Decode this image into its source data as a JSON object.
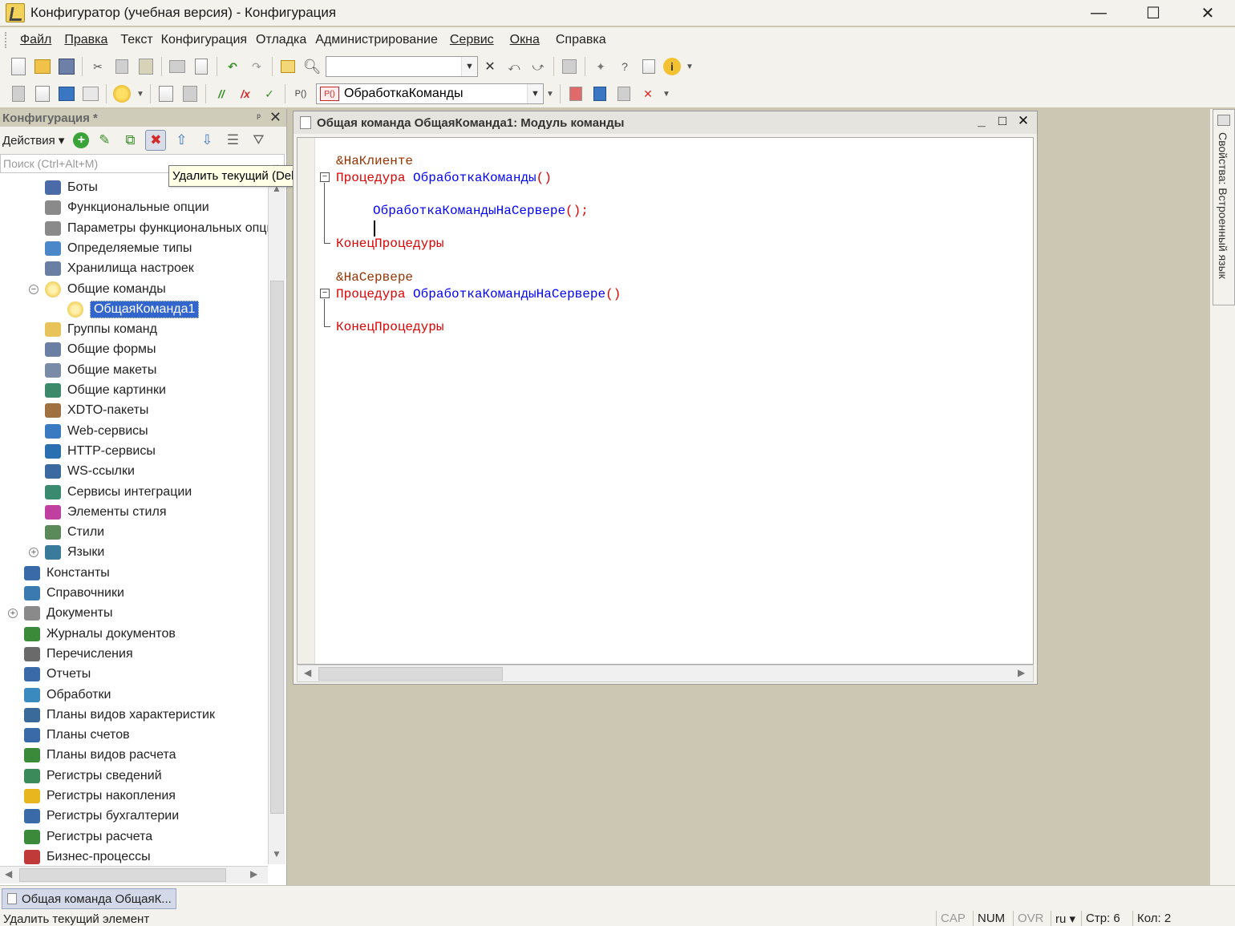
{
  "window": {
    "title": "Конфигуратор (учебная версия) - Конфигурация",
    "minimize": "—",
    "maximize": "☐",
    "close": "✕"
  },
  "menu": {
    "items": [
      "Файл",
      "Правка",
      "Текст",
      "Конфигурация",
      "Отладка",
      "Администрирование",
      "Сервис",
      "Окна",
      "Справка"
    ]
  },
  "toolbar": {
    "search_value": "",
    "procedure_combo": "ОбработкаКоманды",
    "procedure_badge": "P()"
  },
  "left_panel": {
    "title": "Конфигурация *",
    "pin": "ᵖ",
    "close": "✕",
    "actions_label": "Действия ▾",
    "search_placeholder": "Поиск (Ctrl+Alt+M)",
    "tree": [
      {
        "label": "Боты"
      },
      {
        "label": "Функциональные опции"
      },
      {
        "label": "Параметры функциональных опций"
      },
      {
        "label": "Определяемые типы"
      },
      {
        "label": "Хранилища настроек"
      },
      {
        "label": "Общие команды",
        "expanded": true
      },
      {
        "label": "ОбщаяКоманда1",
        "selected": true
      },
      {
        "label": "Группы команд"
      },
      {
        "label": "Общие формы"
      },
      {
        "label": "Общие макеты"
      },
      {
        "label": "Общие картинки"
      },
      {
        "label": "XDTO-пакеты"
      },
      {
        "label": "Web-сервисы"
      },
      {
        "label": "HTTP-сервисы"
      },
      {
        "label": "WS-ссылки"
      },
      {
        "label": "Сервисы интеграции"
      },
      {
        "label": "Элементы стиля"
      },
      {
        "label": "Стили"
      },
      {
        "label": "Языки",
        "expandable": true
      },
      {
        "label": "Константы"
      },
      {
        "label": "Справочники"
      },
      {
        "label": "Документы",
        "expandable": true
      },
      {
        "label": "Журналы документов"
      },
      {
        "label": "Перечисления"
      },
      {
        "label": "Отчеты"
      },
      {
        "label": "Обработки"
      },
      {
        "label": "Планы видов характеристик"
      },
      {
        "label": "Планы счетов"
      },
      {
        "label": "Планы видов расчета"
      },
      {
        "label": "Регистры сведений"
      },
      {
        "label": "Регистры накопления"
      },
      {
        "label": "Регистры бухгалтерии"
      },
      {
        "label": "Регистры расчета"
      },
      {
        "label": "Бизнес-процессы"
      }
    ]
  },
  "tooltip": "Удалить текущий (Del)",
  "editor": {
    "title": "Общая команда ОбщаяКоманда1: Модуль команды",
    "lines": {
      "l1": "&НаКлиенте",
      "l2_kw": "Процедура",
      "l2_name": "ОбработкаКоманды",
      "l2_paren": "()",
      "l3_call": "ОбработкаКомандыНаСервере",
      "l3_tail": "();",
      "l4": "КонецПроцедуры",
      "l5": "&НаСервере",
      "l6_kw": "Процедура",
      "l6_name": "ОбработкаКомандыНаСервере",
      "l6_paren": "()",
      "l7": "КонецПроцедуры"
    }
  },
  "right_panel": {
    "label": "Свойства: Встроенный язык"
  },
  "taskbar": {
    "window_button": "Общая команда ОбщаяК..."
  },
  "statusbar": {
    "text": "Удалить текущий элемент",
    "cap": "CAP",
    "num": "NUM",
    "ovr": "OVR",
    "lang": "ru ▾",
    "row": "Стр: 6",
    "col": "Кол: 2"
  },
  "colors": {
    "keyword": "#e00000",
    "identifier": "#0000ff",
    "preprocessor": "#963200",
    "selection": "#3366cc",
    "workspace": "#cbc7b3"
  }
}
